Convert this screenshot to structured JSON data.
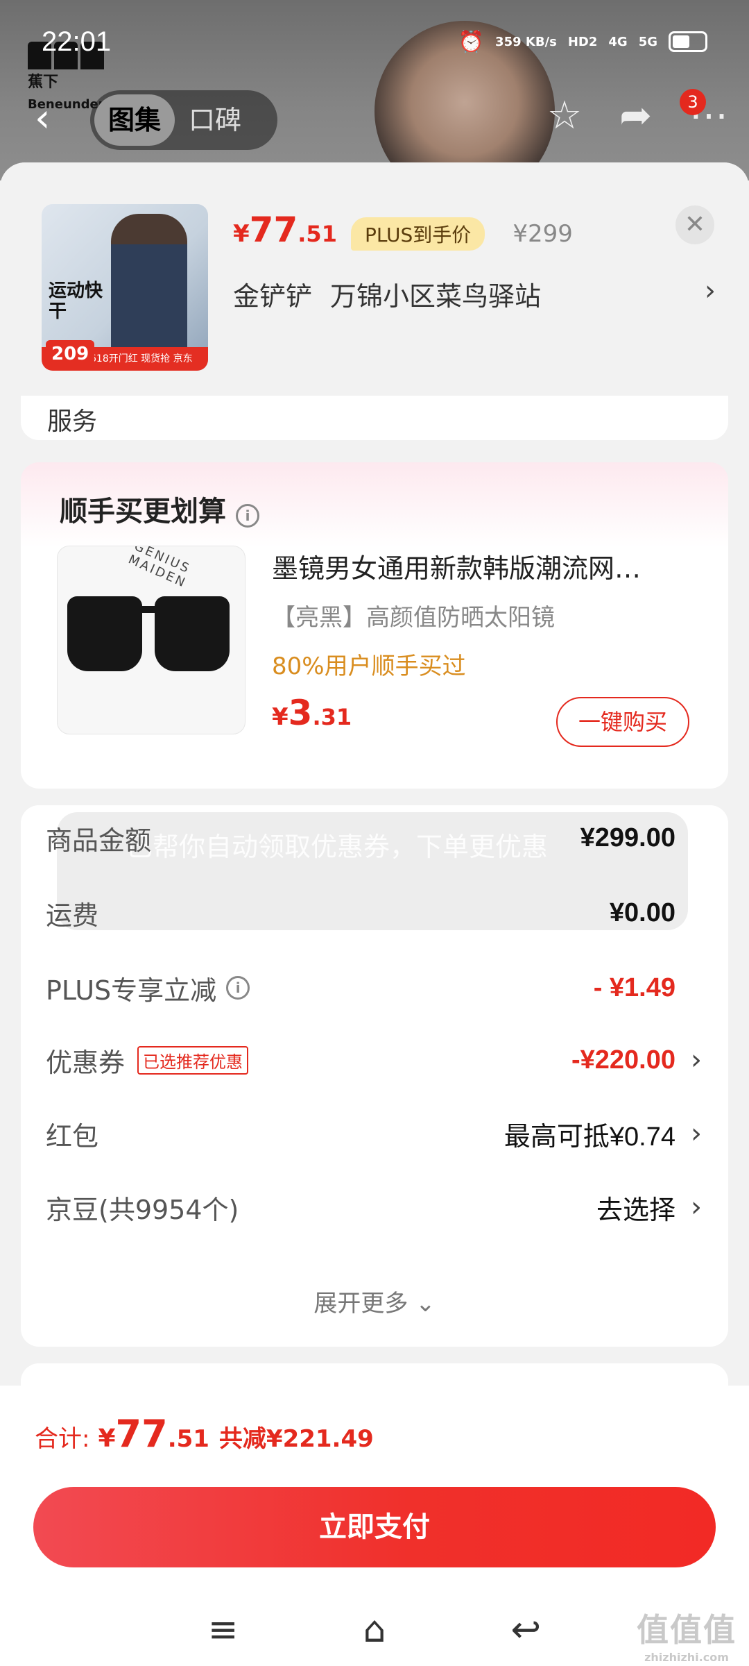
{
  "status": {
    "time": "22:01",
    "net_speed": "359 KB/s",
    "hd": "HD2",
    "sig1": "4G",
    "sig2": "5G"
  },
  "background": {
    "brand_line1": "蕉下",
    "brand_line2": "Beneunder",
    "tabs": [
      "图集",
      "口碑"
    ],
    "cart_badge": "3"
  },
  "product": {
    "thumb_title": "运动快干",
    "thumb_price": "209",
    "thumb_bar": "618开门红 现货抢 京东",
    "price_cur": "¥",
    "price_int": "77",
    "price_dec": ".51",
    "plus_tag": "PLUS到手价",
    "original_price": "¥299",
    "address_name": "金铲铲",
    "address_place": "万锦小区菜鸟驿站"
  },
  "service_row": {
    "label": "服务"
  },
  "addon": {
    "title": "顺手买更划算",
    "name": "墨镜男女通用新款韩版潮流网…",
    "spec": "【亮黑】高颜值防晒太阳镜",
    "stat": "80%用户顺手买过",
    "price_cur": "¥",
    "price_int": "3",
    "price_dec": ".31",
    "buy_label": "一键购买",
    "glasses_brand": "GENIUS MAIDEN"
  },
  "toast": "已帮你自动领取优惠券，下单更优惠",
  "summary": {
    "rows": [
      {
        "label": "商品金额",
        "value": "¥299.00"
      },
      {
        "label": "运费",
        "value": "¥0.00"
      },
      {
        "label": "PLUS专享立减",
        "value": "- ¥1.49"
      },
      {
        "label": "优惠券",
        "tag": "已选推荐优惠",
        "value": "-¥220.00"
      },
      {
        "label": "红包",
        "value": "最高可抵¥0.74"
      },
      {
        "label": "京豆(共9954个)",
        "value": "去选择"
      }
    ],
    "expand": "展开更多"
  },
  "footer": {
    "total_label": "合计:",
    "total_cur": "¥",
    "total_int": "77",
    "total_dec": ".51",
    "savings": "共减¥221.49",
    "pay_label": "立即支付"
  },
  "watermark": {
    "text": "值值值",
    "sub": "zhizhizhi.com"
  },
  "colors": {
    "accent": "#e4291e",
    "plus_tag_bg": "#fbe7a5",
    "stat_orange": "#d98d1f"
  }
}
